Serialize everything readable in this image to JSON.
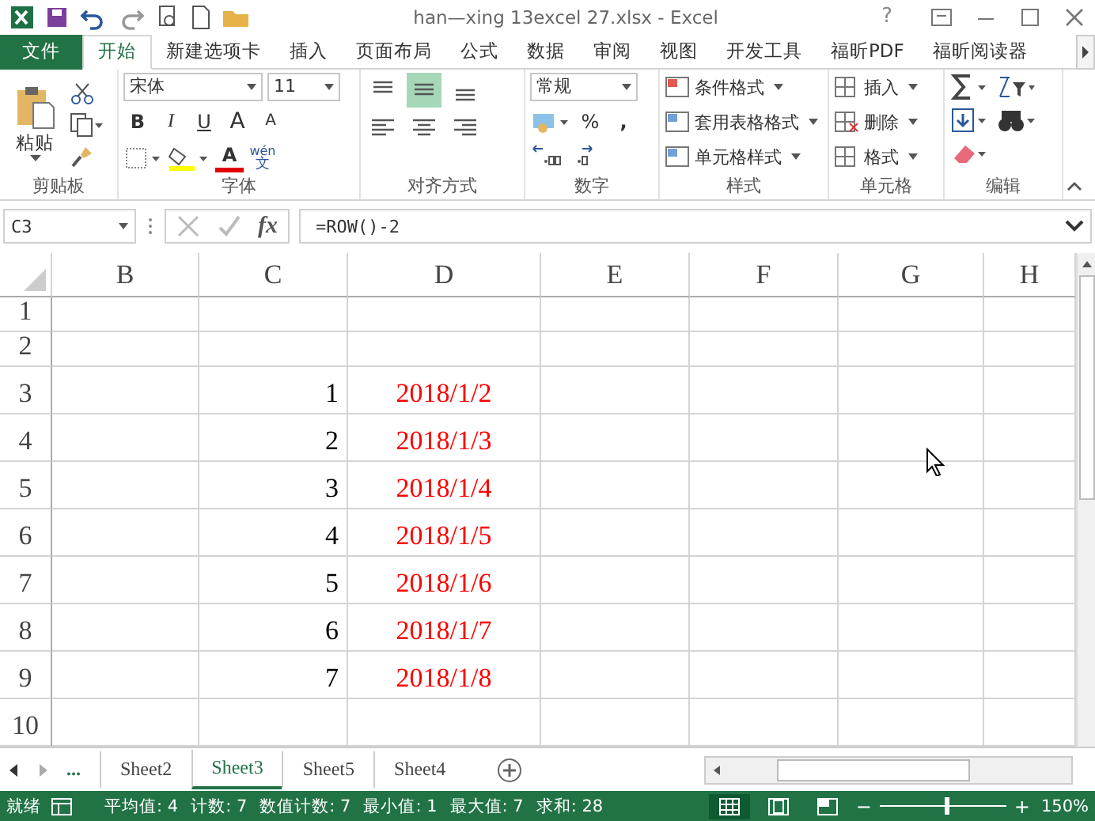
{
  "window": {
    "title": "han—xing 13excel 27.xlsx - Excel",
    "help": "?"
  },
  "tabs": [
    {
      "label": "文件",
      "kind": "file",
      "selected": false
    },
    {
      "label": "开始",
      "kind": "tab",
      "selected": true
    },
    {
      "label": "新建选项卡",
      "kind": "tab",
      "selected": false
    },
    {
      "label": "插入",
      "kind": "tab",
      "selected": false
    },
    {
      "label": "页面布局",
      "kind": "tab",
      "selected": false
    },
    {
      "label": "公式",
      "kind": "tab",
      "selected": false
    },
    {
      "label": "数据",
      "kind": "tab",
      "selected": false
    },
    {
      "label": "审阅",
      "kind": "tab",
      "selected": false
    },
    {
      "label": "视图",
      "kind": "tab",
      "selected": false
    },
    {
      "label": "开发工具",
      "kind": "tab",
      "selected": false
    },
    {
      "label": "福昕PDF",
      "kind": "tab",
      "selected": false
    },
    {
      "label": "福昕阅读器",
      "kind": "tab",
      "selected": false
    }
  ],
  "ribbon": {
    "clipboard": {
      "label": "剪贴板",
      "paste": "粘贴"
    },
    "font": {
      "label": "字体",
      "name": "宋体",
      "size": "11",
      "bold": "B",
      "italic": "I",
      "underline": "U",
      "grow": "A",
      "shrink": "A",
      "color_letter": "A",
      "phonetic_top": "wén",
      "phonetic_bottom": "文"
    },
    "alignment": {
      "label": "对齐方式",
      "buttons": [
        {
          "kind": "top",
          "selected": false
        },
        {
          "kind": "middle",
          "selected": true
        },
        {
          "kind": "bottom",
          "selected": false
        },
        {
          "kind": "left",
          "selected": false
        },
        {
          "kind": "center",
          "selected": false
        },
        {
          "kind": "right",
          "selected": false
        }
      ]
    },
    "number": {
      "label": "数字",
      "format": "常规",
      "percent": "%",
      "comma": ","
    },
    "styles": {
      "label": "样式",
      "items": [
        "条件格式",
        "套用表格格式",
        "单元格样式"
      ]
    },
    "cells": {
      "label": "单元格",
      "items": [
        "插入",
        "删除",
        "格式"
      ]
    },
    "editing": {
      "label": "编辑"
    }
  },
  "formula_bar": {
    "name_box": "C3",
    "fx": "fx",
    "formula": "=ROW()-2"
  },
  "columns": [
    {
      "label": "B"
    },
    {
      "label": "C",
      "color": "#000000"
    },
    {
      "label": "D",
      "color": "#ff0000"
    },
    {
      "label": "E"
    },
    {
      "label": "F"
    },
    {
      "label": "G"
    },
    {
      "label": "H"
    }
  ],
  "rows": [
    {
      "label": "1",
      "cells": [
        "",
        "",
        "",
        "",
        "",
        "",
        ""
      ]
    },
    {
      "label": "2",
      "cells": [
        "",
        "",
        "",
        "",
        "",
        "",
        ""
      ]
    },
    {
      "label": "3",
      "cells": [
        "",
        "1",
        "2018/1/2",
        "",
        "",
        "",
        ""
      ]
    },
    {
      "label": "4",
      "cells": [
        "",
        "2",
        "2018/1/3",
        "",
        "",
        "",
        ""
      ]
    },
    {
      "label": "5",
      "cells": [
        "",
        "3",
        "2018/1/4",
        "",
        "",
        "",
        ""
      ]
    },
    {
      "label": "6",
      "cells": [
        "",
        "4",
        "2018/1/5",
        "",
        "",
        "",
        ""
      ]
    },
    {
      "label": "7",
      "cells": [
        "",
        "5",
        "2018/1/6",
        "",
        "",
        "",
        ""
      ]
    },
    {
      "label": "8",
      "cells": [
        "",
        "6",
        "2018/1/7",
        "",
        "",
        "",
        ""
      ]
    },
    {
      "label": "9",
      "cells": [
        "",
        "7",
        "2018/1/8",
        "",
        "",
        "",
        ""
      ]
    },
    {
      "label": "10",
      "cells": [
        "",
        "",
        "",
        "",
        "",
        "",
        ""
      ]
    }
  ],
  "sheet_tabs": {
    "more": "...",
    "sheets": [
      {
        "label": "Sheet2",
        "selected": false
      },
      {
        "label": "Sheet3",
        "selected": true
      },
      {
        "label": "Sheet5",
        "selected": false
      },
      {
        "label": "Sheet4",
        "selected": false
      }
    ]
  },
  "status_bar": {
    "ready": "就绪",
    "stats": [
      "平均值: 4",
      "计数: 7",
      "数值计数: 7",
      "最小值: 1",
      "最大值: 7",
      "求和: 28"
    ],
    "views": [
      {
        "kind": "normal",
        "selected": true
      },
      {
        "kind": "layout",
        "selected": false
      },
      {
        "kind": "break",
        "selected": false
      }
    ],
    "zoom": {
      "minus": "−",
      "plus": "+",
      "level": 0.52,
      "reading": "150%"
    }
  }
}
